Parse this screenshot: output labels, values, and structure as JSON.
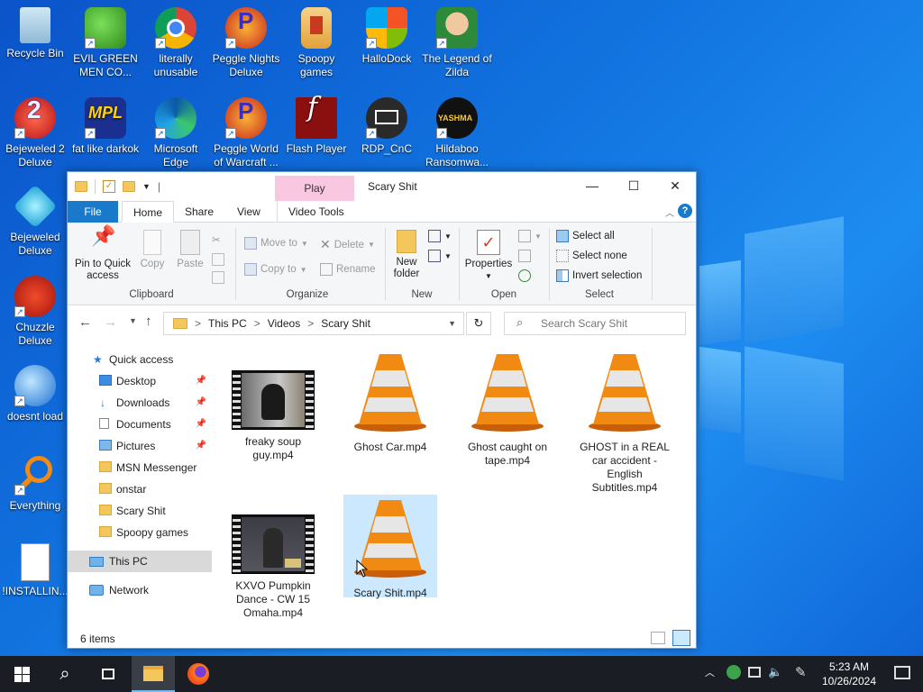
{
  "desktop": {
    "icons": [
      {
        "name": "recycle-bin",
        "label": "Recycle Bin"
      },
      {
        "name": "evil-green-men",
        "label": "EVIL GREEN MEN CO..."
      },
      {
        "name": "literally-unusable",
        "label": "literally unusable"
      },
      {
        "name": "peggle-nights",
        "label": "Peggle Nights Deluxe"
      },
      {
        "name": "spoopy-games",
        "label": "Spoopy games"
      },
      {
        "name": "hallodock",
        "label": "HalloDock"
      },
      {
        "name": "legend-of-zilda",
        "label": "The Legend of Zilda"
      },
      {
        "name": "bejeweled-2",
        "label": "Bejeweled 2 Deluxe"
      },
      {
        "name": "fat-like-darkok",
        "label": "fat like darkok"
      },
      {
        "name": "microsoft-edge",
        "label": "Microsoft Edge"
      },
      {
        "name": "peggle-world",
        "label": "Peggle World of Warcraft ..."
      },
      {
        "name": "flash-player",
        "label": "Flash Player"
      },
      {
        "name": "rdp-cnc",
        "label": "RDP_CnC"
      },
      {
        "name": "hildaboo",
        "label": "Hildaboo Ransomwa..."
      },
      {
        "name": "bejeweled-deluxe",
        "label": "Bejeweled Deluxe"
      },
      {
        "name": "chuzzle",
        "label": "Chuzzle Deluxe"
      },
      {
        "name": "doesnt-load",
        "label": "doesnt load"
      },
      {
        "name": "everything",
        "label": "Everything"
      },
      {
        "name": "installing",
        "label": "!INSTALLIN..."
      }
    ]
  },
  "explorer": {
    "quick_access_sep": "|",
    "play_tab": "Play",
    "title": "Scary Shit",
    "tabs": [
      "File",
      "Home",
      "Share",
      "View",
      "Video Tools"
    ],
    "ribbon": {
      "pin": "Pin to Quick access",
      "copy": "Copy",
      "paste": "Paste",
      "move_to": "Move to",
      "copy_to": "Copy to",
      "delete": "Delete",
      "rename": "Rename",
      "new_folder": "New folder",
      "properties": "Properties",
      "select_all": "Select all",
      "select_none": "Select none",
      "invert": "Invert selection",
      "groups": [
        "Clipboard",
        "Organize",
        "New",
        "Open",
        "Select"
      ]
    },
    "address": {
      "parts": [
        "This PC",
        "Videos",
        "Scary Shit"
      ],
      "sep": ">"
    },
    "search_placeholder": "Search Scary Shit",
    "nav": {
      "quick_access": "Quick access",
      "items": [
        "Desktop",
        "Downloads",
        "Documents",
        "Pictures",
        "MSN Messenger",
        "onstar",
        "Scary Shit",
        "Spoopy games"
      ],
      "this_pc": "This PC",
      "network": "Network"
    },
    "files": [
      "freaky soup guy.mp4",
      "Ghost Car.mp4",
      "Ghost caught on tape.mp4",
      "GHOST in a REAL car accident - English Subtitles.mp4",
      "KXVO Pumpkin Dance - CW 15 Omaha.mp4",
      "Scary Shit.mp4"
    ],
    "status": "6 items"
  },
  "taskbar": {
    "time": "5:23 AM",
    "date": "10/26/2024"
  },
  "colors": {
    "accent": "#1979ca",
    "selection": "#cce8ff",
    "cone": "#f08a12"
  }
}
